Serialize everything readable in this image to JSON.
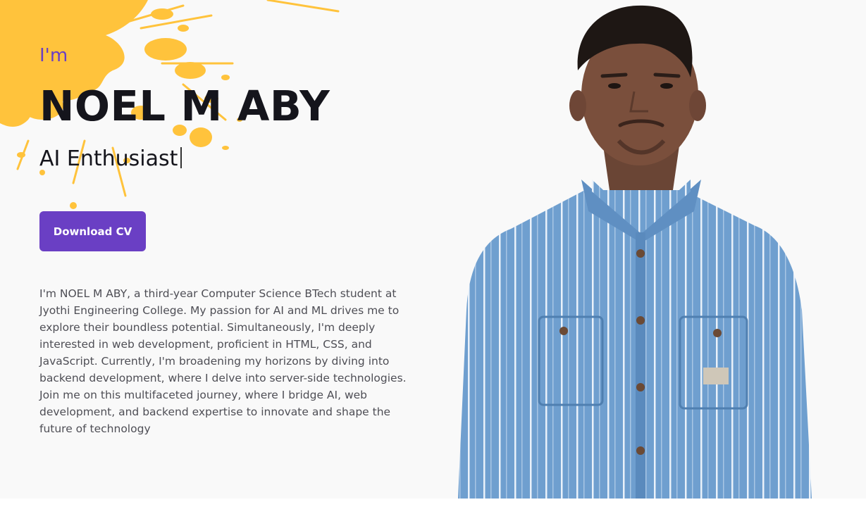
{
  "hero": {
    "greeting": "I'm",
    "name": "NOEL M ABY",
    "role": "AI Enthusiast",
    "cv_button_label": "Download CV",
    "about": "I'm NOEL M ABY, a third-year Computer Science BTech student at Jyothi Engineering College. My passion for AI and ML drives me to explore their boundless potential. Simultaneously, I'm deeply interested in web development, proficient in HTML, CSS, and JavaScript. Currently, I'm broadening my horizons by diving into backend development, where I delve into server-side technologies. Join me on this multifaceted journey, where I bridge AI, web development, and backend expertise to innovate and shape the future of technology"
  },
  "colors": {
    "accent": "#6a3fc4",
    "splash": "#ffc33c",
    "heading": "#15151c",
    "body_text": "#4e4e55",
    "background": "#f9f9f9",
    "shirt": "#6f9fcf"
  },
  "icons": {
    "paint_splash": "paint-splash-decoration",
    "profile_photo": "profile-portrait"
  }
}
